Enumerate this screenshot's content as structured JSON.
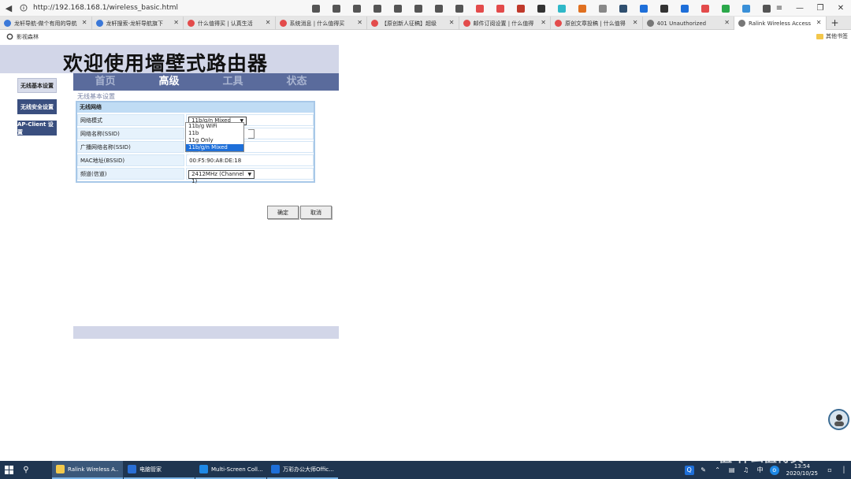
{
  "browser": {
    "url": "http://192.168.168.1/wireless_basic.html",
    "tabs": [
      {
        "label": "龙轩导航-做个有用的导航",
        "color": "#3b78d8"
      },
      {
        "label": "龙轩搜索-龙轩导航旗下",
        "color": "#3b78d8"
      },
      {
        "label": "什么值得买 | 认真生活",
        "color": "#e34b4b"
      },
      {
        "label": "系统消息 | 什么值得买",
        "color": "#e34b4b"
      },
      {
        "label": "【原创新人征稿】超级",
        "color": "#e34b4b"
      },
      {
        "label": "邮件订阅设置 | 什么值得",
        "color": "#e34b4b"
      },
      {
        "label": "原创文章投稿 | 什么值得",
        "color": "#e34b4b"
      },
      {
        "label": "401 Unauthorized",
        "color": "#777777"
      },
      {
        "label": "Ralink Wireless Access",
        "color": "#777777"
      }
    ],
    "bookmark_left": "影视森林",
    "bookmark_right": "其他书签",
    "toolbar_icon_colors": [
      "#555555",
      "#555555",
      "#555555",
      "#555555",
      "#555555",
      "#555555",
      "#555555",
      "#555555",
      "#e34b4b",
      "#e34b4b",
      "#c0392b",
      "#333333",
      "#2fb8c8",
      "#e07020",
      "#888888",
      "#2f4f6f",
      "#1e6fd9",
      "#333333",
      "#1e6fd9",
      "#e34b4b",
      "#2aa84a",
      "#3a90d8",
      "#555555"
    ]
  },
  "router": {
    "banner_title": "欢迎使用墙壁式路由器",
    "menu": [
      "首页",
      "高级",
      "工具",
      "状态"
    ],
    "active_menu": "高级",
    "sidebar": [
      "无线基本设置",
      "无线安全设置",
      "AP-Client 设置"
    ],
    "section_title": "无线基本设置",
    "table_header": "无线网络",
    "rows": [
      {
        "label": "网络模式",
        "value": "11b/g/n Mixed Mode"
      },
      {
        "label": "网络名称(SSID)",
        "value": ""
      },
      {
        "label": "广播网络名称(SSID)",
        "value": ""
      },
      {
        "label": "MAC地址(BSSID)",
        "value": "00:F5:90:A8:DE:18"
      },
      {
        "label": "频道(信道)",
        "value": "2412MHz (Channel 1)"
      }
    ],
    "mode_options": [
      "11b/g WiFi",
      "11b",
      "11g Only",
      "11b/g/n Mixed Mode"
    ],
    "selected_mode": "11b/g/n Mixed Mode",
    "ok_label": "确定",
    "cancel_label": "取消"
  },
  "taskbar": {
    "items": [
      {
        "label": "Ralink Wireless A...",
        "color": "#f2c94c"
      },
      {
        "label": "电脑管家",
        "color": "#2a6fd6"
      },
      {
        "label": "Multi-Screen Coll...",
        "color": "#1e88e5"
      },
      {
        "label": "万彩办公大师Offic...",
        "color": "#1e6fd9"
      }
    ],
    "ime": "中",
    "time": "13:54",
    "date": "2020/10/25"
  },
  "watermark": "值 什么值得买"
}
